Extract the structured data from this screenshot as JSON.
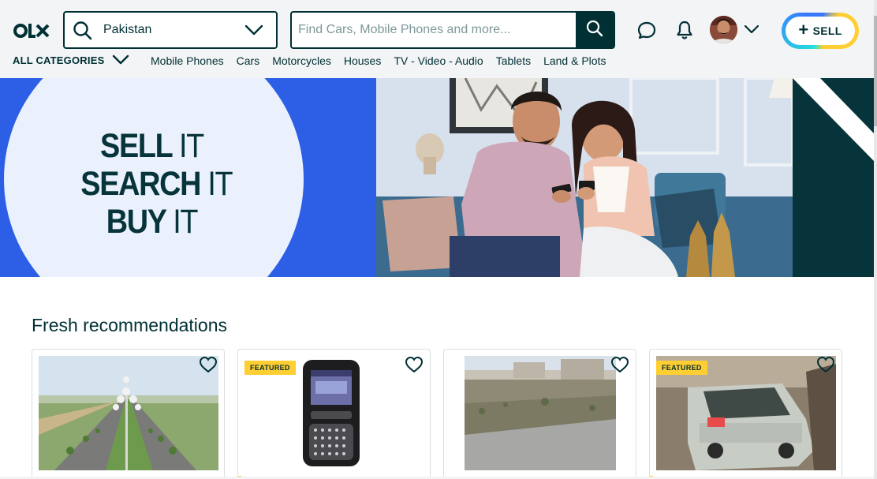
{
  "header": {
    "logo_text": "OLX",
    "location": {
      "value": "Pakistan"
    },
    "search": {
      "placeholder": "Find Cars, Mobile Phones and more..."
    },
    "sell_label": "SELL",
    "icons": [
      "search-icon",
      "chevron-down-icon",
      "chat-icon",
      "bell-icon",
      "avatar",
      "plus-icon"
    ]
  },
  "categories": {
    "all_label": "ALL CATEGORIES",
    "items": [
      "Mobile Phones",
      "Cars",
      "Motorcycles",
      "Houses",
      "TV - Video - Audio",
      "Tablets",
      "Land & Plots"
    ]
  },
  "hero": {
    "line1_bold": "SELL",
    "line1_thin": "IT",
    "line2_bold": "SEARCH",
    "line2_thin": "IT",
    "line3_bold": "BUY",
    "line3_thin": "IT"
  },
  "recommendations": {
    "title": "Fresh recommendations",
    "cards": [
      {
        "featured": false,
        "image": "highway-with-lamp-posts"
      },
      {
        "featured": true,
        "badge": "FEATURED",
        "image": "nokia-qwerty-phone"
      },
      {
        "featured": false,
        "image": "empty-plot-land"
      },
      {
        "featured": true,
        "badge": "FEATURED",
        "image": "silver-sedan-car"
      }
    ]
  },
  "colors": {
    "brand_dark": "#002f34",
    "hero_blue": "#2d5fe6",
    "hero_circle": "#eaf1fd",
    "featured_yellow": "#ffce32",
    "sell_teal": "#23e5db",
    "sell_blue": "#3a77ff"
  }
}
